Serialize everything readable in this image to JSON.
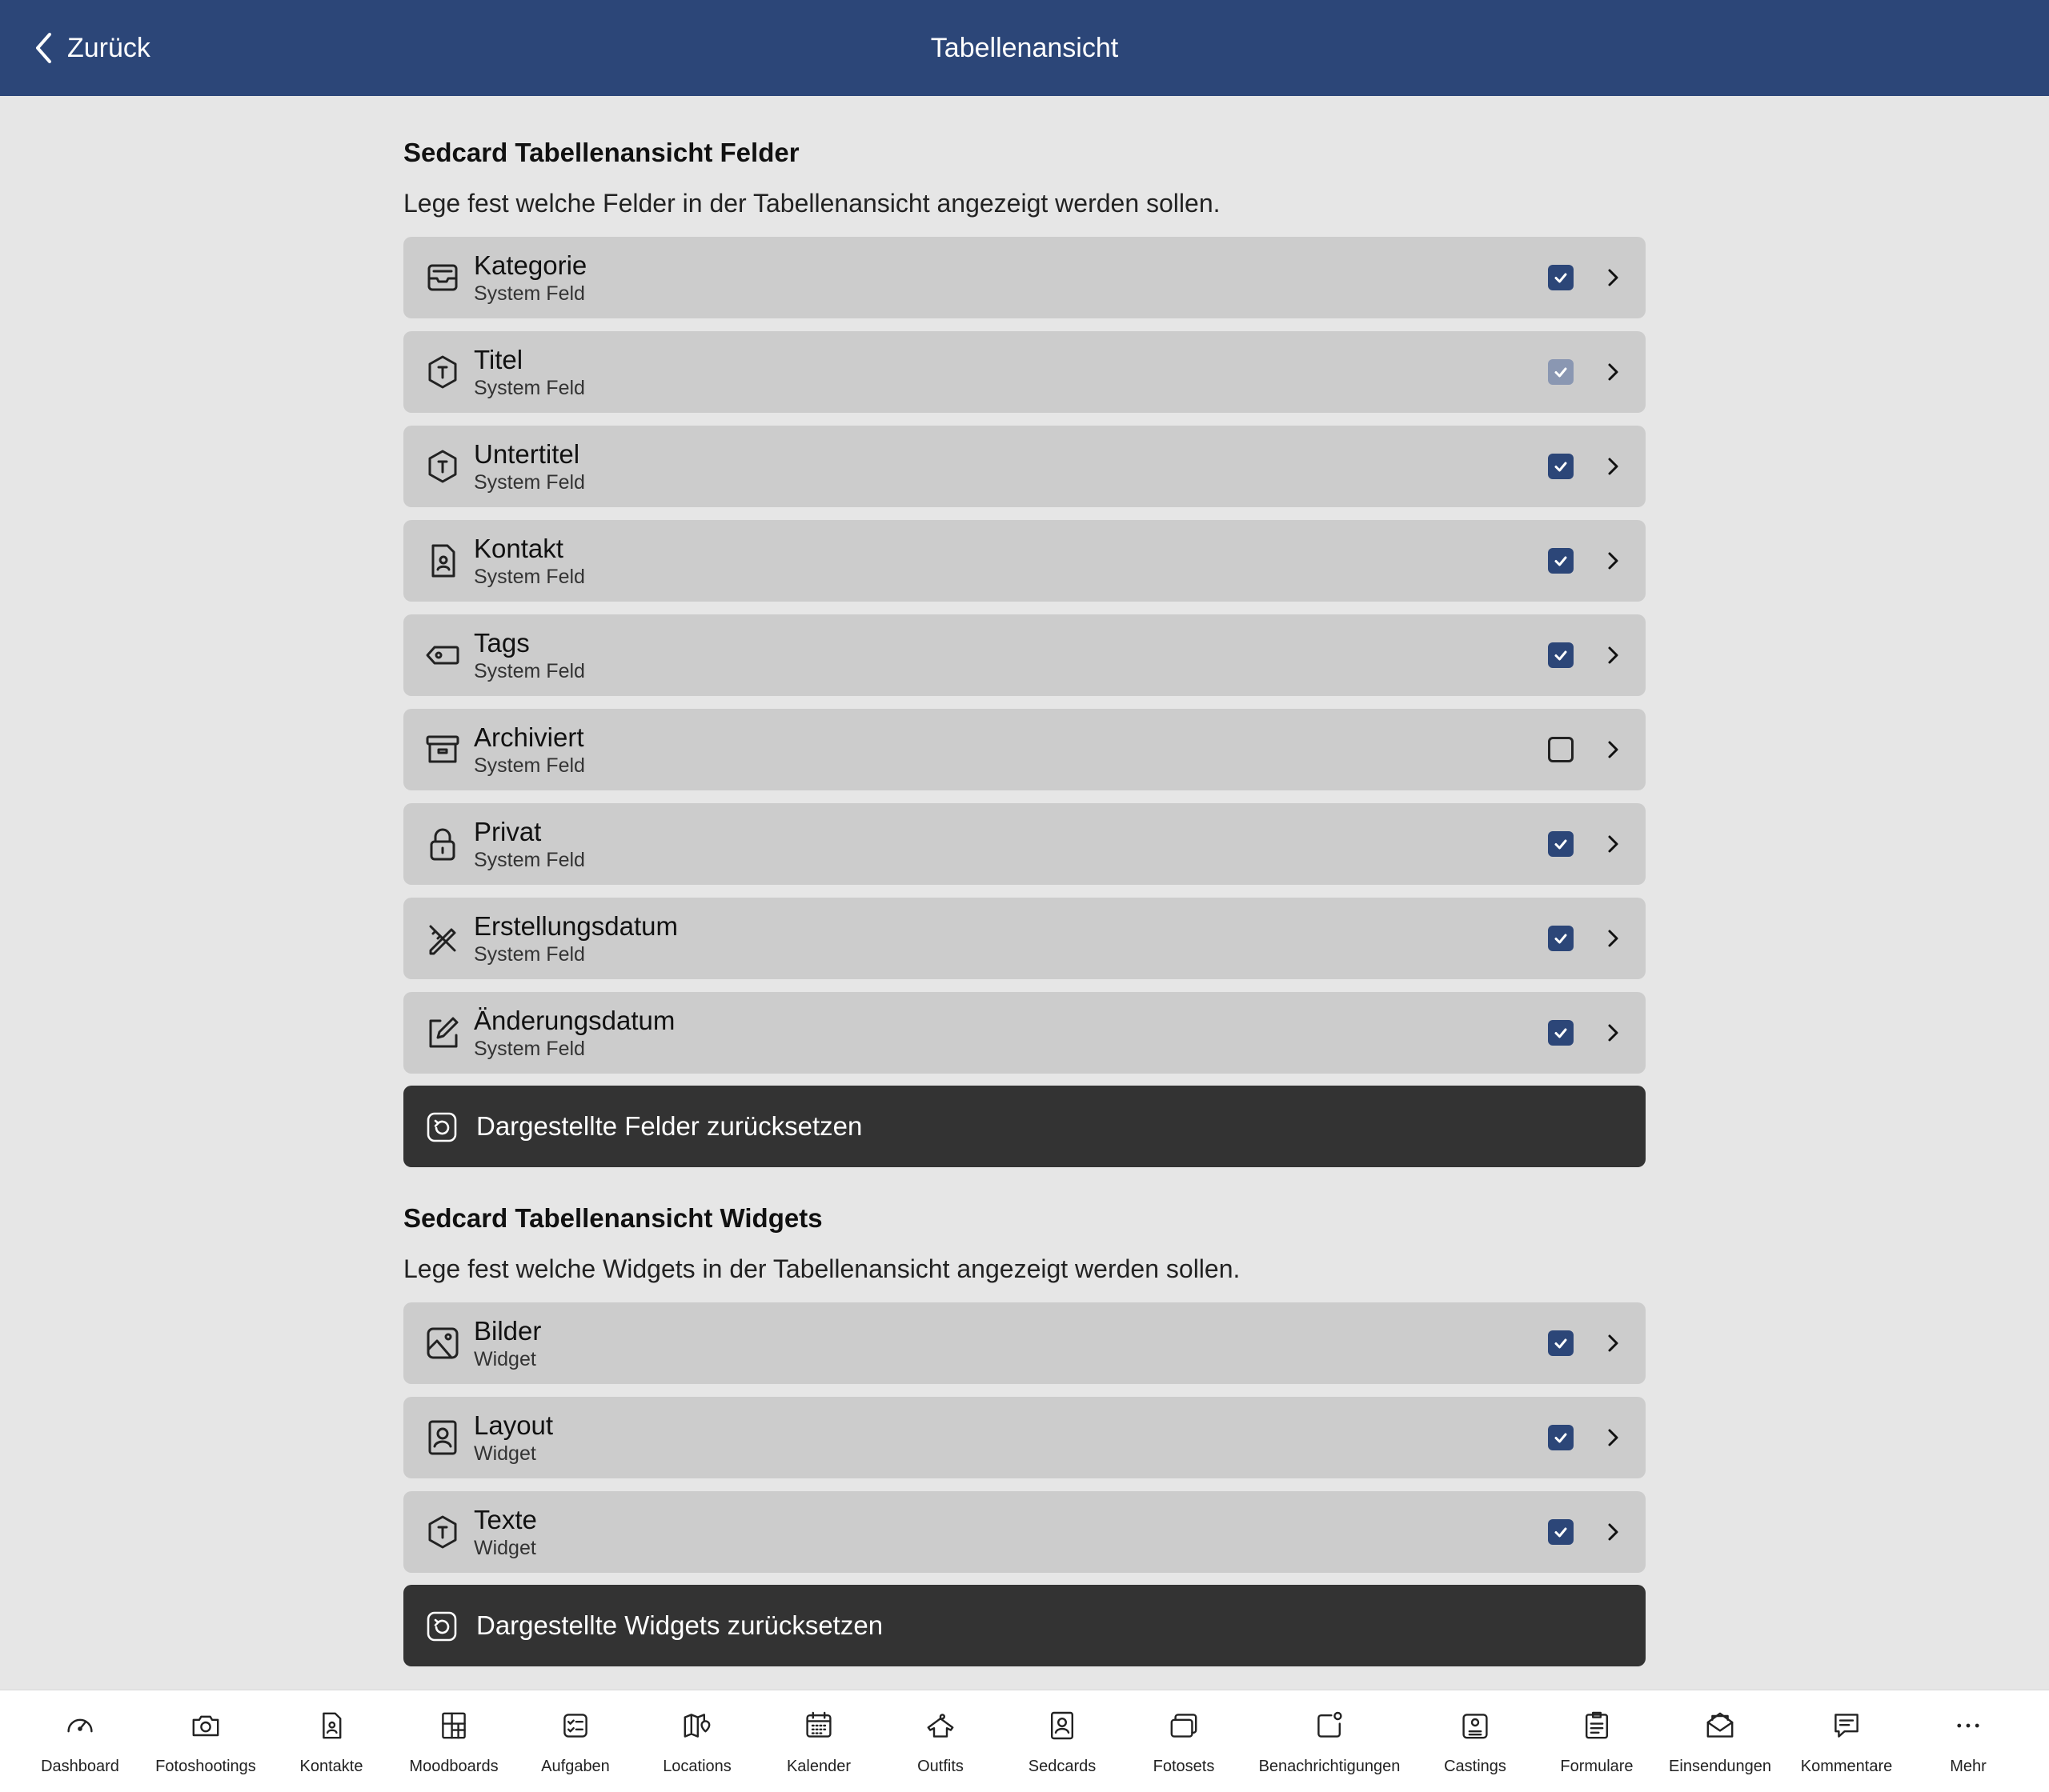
{
  "header": {
    "back_label": "Zurück",
    "title": "Tabellenansicht"
  },
  "colors": {
    "header_bg": "#2c4678",
    "checkbox_on": "#2c4678",
    "reset_bg": "#333333",
    "row_bg": "#cccccc",
    "page_bg": "#e6e6e6"
  },
  "fields_section": {
    "title": "Sedcard Tabellenansicht Felder",
    "description": "Lege fest welche Felder in der Tabellenansicht angezeigt werden sollen.",
    "items": [
      {
        "title": "Kategorie",
        "subtitle": "System Feld",
        "icon": "inbox-icon",
        "checked": true
      },
      {
        "title": "Titel",
        "subtitle": "System Feld",
        "icon": "text-hexagon-icon",
        "checked": true,
        "disabled": true
      },
      {
        "title": "Untertitel",
        "subtitle": "System Feld",
        "icon": "text-hexagon-icon",
        "checked": true
      },
      {
        "title": "Kontakt",
        "subtitle": "System Feld",
        "icon": "contact-file-icon",
        "checked": true
      },
      {
        "title": "Tags",
        "subtitle": "System Feld",
        "icon": "tag-icon",
        "checked": true
      },
      {
        "title": "Archiviert",
        "subtitle": "System Feld",
        "icon": "archive-icon",
        "checked": false
      },
      {
        "title": "Privat",
        "subtitle": "System Feld",
        "icon": "lock-icon",
        "checked": true
      },
      {
        "title": "Erstellungsdatum",
        "subtitle": "System Feld",
        "icon": "pencil-ruler-icon",
        "checked": true
      },
      {
        "title": "Änderungsdatum",
        "subtitle": "System Feld",
        "icon": "edit-icon",
        "checked": true
      }
    ],
    "reset_label": "Dargestellte Felder zurücksetzen"
  },
  "widgets_section": {
    "title": "Sedcard Tabellenansicht Widgets",
    "description": "Lege fest welche Widgets in der Tabellenansicht angezeigt werden sollen.",
    "items": [
      {
        "title": "Bilder",
        "subtitle": "Widget",
        "icon": "image-icon",
        "checked": true
      },
      {
        "title": "Layout",
        "subtitle": "Widget",
        "icon": "portrait-icon",
        "checked": true
      },
      {
        "title": "Texte",
        "subtitle": "Widget",
        "icon": "text-hexagon-icon",
        "checked": true
      }
    ],
    "reset_label": "Dargestellte Widgets zurücksetzen"
  },
  "tabbar": [
    {
      "label": "Dashboard",
      "icon": "gauge-icon"
    },
    {
      "label": "Fotoshootings",
      "icon": "camera-icon"
    },
    {
      "label": "Kontakte",
      "icon": "contact-file-icon"
    },
    {
      "label": "Moodboards",
      "icon": "moodboard-icon"
    },
    {
      "label": "Aufgaben",
      "icon": "task-list-icon"
    },
    {
      "label": "Locations",
      "icon": "map-pin-icon"
    },
    {
      "label": "Kalender",
      "icon": "calendar-icon"
    },
    {
      "label": "Outfits",
      "icon": "shirt-icon"
    },
    {
      "label": "Sedcards",
      "icon": "portrait-icon"
    },
    {
      "label": "Fotosets",
      "icon": "stack-icon"
    },
    {
      "label": "Benachrichtigungen",
      "icon": "notification-icon"
    },
    {
      "label": "Castings",
      "icon": "casting-icon"
    },
    {
      "label": "Formulare",
      "icon": "clipboard-icon"
    },
    {
      "label": "Einsendungen",
      "icon": "mail-icon"
    },
    {
      "label": "Kommentare",
      "icon": "comment-icon"
    },
    {
      "label": "Mehr",
      "icon": "more-icon"
    }
  ]
}
